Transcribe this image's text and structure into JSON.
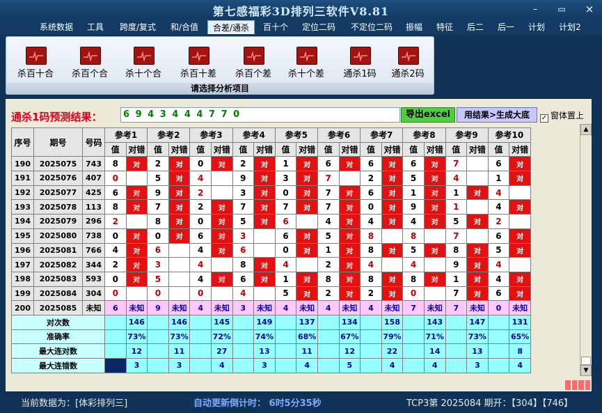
{
  "window": {
    "title": "第七感福彩3D排列三软件V8.81",
    "min_label": "–",
    "max_label": "▭",
    "close_label": "×"
  },
  "menu": [
    "系统数据",
    "工具",
    "跨度/复式",
    "和/合值",
    "合差/通杀",
    "百十个",
    "定位二码",
    "不定位二码",
    "振幅",
    "特征",
    "后二",
    "后一",
    "计划",
    "计划2"
  ],
  "menu_active_index": 4,
  "ribbon": {
    "buttons": [
      "杀百十合",
      "杀百个合",
      "杀十个合",
      "杀百十差",
      "杀百个差",
      "杀十个差",
      "通杀1码",
      "通杀2码"
    ],
    "footer": "请选择分析项目"
  },
  "prediction": {
    "label": "通杀1码预测结果：",
    "value": "6 9 4 3 4 4 4 7 7 0",
    "export_button": "导出excel",
    "generate_button": "用结果>生成大底",
    "checkbox_label": "窗体置上",
    "checkbox_checked": true
  },
  "table": {
    "col_seq": "序号",
    "col_period": "期号",
    "col_number": "号码",
    "ref_names": [
      "参考1",
      "参考2",
      "参考3",
      "参考4",
      "参考5",
      "参考6",
      "参考7",
      "参考8",
      "参考9",
      "参考10"
    ],
    "sub_value": "值",
    "sub_result": "对错",
    "rows": [
      {
        "seq": "190",
        "period": "2025075",
        "num": "743",
        "cells": [
          [
            8,
            1
          ],
          [
            2,
            1
          ],
          [
            0,
            1
          ],
          [
            2,
            1
          ],
          [
            1,
            1
          ],
          [
            6,
            1
          ],
          [
            6,
            1
          ],
          [
            6,
            1
          ],
          [
            7,
            0
          ],
          [
            6,
            1
          ]
        ]
      },
      {
        "seq": "191",
        "period": "2025076",
        "num": "407",
        "cells": [
          [
            0,
            0
          ],
          [
            5,
            1
          ],
          [
            4,
            0
          ],
          [
            9,
            1
          ],
          [
            3,
            1
          ],
          [
            7,
            0
          ],
          [
            2,
            1
          ],
          [
            5,
            1
          ],
          [
            4,
            0
          ],
          [
            1,
            1
          ]
        ]
      },
      {
        "seq": "192",
        "period": "2025077",
        "num": "425",
        "cells": [
          [
            6,
            1
          ],
          [
            9,
            1
          ],
          [
            2,
            0
          ],
          [
            3,
            1
          ],
          [
            0,
            1
          ],
          [
            7,
            1
          ],
          [
            6,
            1
          ],
          [
            1,
            1
          ],
          [
            1,
            1
          ],
          [
            4,
            0
          ]
        ]
      },
      {
        "seq": "193",
        "period": "2025078",
        "num": "113",
        "cells": [
          [
            8,
            1
          ],
          [
            7,
            1
          ],
          [
            2,
            1
          ],
          [
            7,
            1
          ],
          [
            7,
            1
          ],
          [
            7,
            1
          ],
          [
            0,
            1
          ],
          [
            9,
            1
          ],
          [
            1,
            0
          ],
          [
            4,
            1
          ]
        ]
      },
      {
        "seq": "194",
        "period": "2025079",
        "num": "296",
        "cells": [
          [
            2,
            0
          ],
          [
            8,
            1
          ],
          [
            0,
            1
          ],
          [
            5,
            1
          ],
          [
            6,
            0
          ],
          [
            4,
            1
          ],
          [
            4,
            1
          ],
          [
            4,
            1
          ],
          [
            5,
            1
          ],
          [
            2,
            0
          ]
        ]
      },
      {
        "seq": "195",
        "period": "2025080",
        "num": "738",
        "cells": [
          [
            0,
            1
          ],
          [
            0,
            1
          ],
          [
            6,
            1
          ],
          [
            3,
            0
          ],
          [
            6,
            1
          ],
          [
            5,
            1
          ],
          [
            8,
            0
          ],
          [
            8,
            0
          ],
          [
            7,
            0
          ],
          [
            6,
            1
          ]
        ]
      },
      {
        "seq": "196",
        "period": "2025081",
        "num": "766",
        "cells": [
          [
            4,
            1
          ],
          [
            6,
            0
          ],
          [
            4,
            1
          ],
          [
            6,
            0
          ],
          [
            0,
            1
          ],
          [
            1,
            1
          ],
          [
            8,
            1
          ],
          [
            5,
            1
          ],
          [
            8,
            1
          ],
          [
            5,
            1
          ]
        ]
      },
      {
        "seq": "197",
        "period": "2025082",
        "num": "344",
        "cells": [
          [
            2,
            1
          ],
          [
            3,
            0
          ],
          [
            4,
            0
          ],
          [
            8,
            1
          ],
          [
            4,
            0
          ],
          [
            2,
            1
          ],
          [
            4,
            0
          ],
          [
            4,
            0
          ],
          [
            9,
            1
          ],
          [
            4,
            0
          ]
        ]
      },
      {
        "seq": "198",
        "period": "2025083",
        "num": "593",
        "cells": [
          [
            0,
            1
          ],
          [
            5,
            0
          ],
          [
            4,
            1
          ],
          [
            6,
            1
          ],
          [
            1,
            1
          ],
          [
            8,
            1
          ],
          [
            8,
            1
          ],
          [
            8,
            1
          ],
          [
            1,
            1
          ],
          [
            4,
            1
          ]
        ]
      },
      {
        "seq": "199",
        "period": "2025084",
        "num": "304",
        "cells": [
          [
            0,
            0
          ],
          [
            0,
            0
          ],
          [
            0,
            0
          ],
          [
            4,
            0
          ],
          [
            5,
            1
          ],
          [
            2,
            1
          ],
          [
            2,
            1
          ],
          [
            0,
            0
          ],
          [
            7,
            1
          ],
          [
            6,
            1
          ]
        ]
      }
    ],
    "pred_row": {
      "seq": "200",
      "period": "2025085",
      "num": "未知",
      "values": [
        "6",
        "9",
        "4",
        "3",
        "4",
        "4",
        "4",
        "7",
        "7",
        "0"
      ],
      "unknown": "未知"
    },
    "stats": [
      {
        "label": "对次数",
        "values": [
          "146",
          "146",
          "145",
          "149",
          "137",
          "134",
          "158",
          "143",
          "147",
          "131"
        ]
      },
      {
        "label": "准确率",
        "values": [
          "73%",
          "73%",
          "72%",
          "74%",
          "68%",
          "67%",
          "79%",
          "71%",
          "73%",
          "65%"
        ]
      },
      {
        "label": "最大连对数",
        "values": [
          "12",
          "11",
          "27",
          "13",
          "11",
          "12",
          "22",
          "14",
          "13",
          "8"
        ]
      },
      {
        "label": "最大连错数",
        "values": [
          "3",
          "3",
          "4",
          "3",
          "4",
          "5",
          "4",
          "4",
          "3",
          "4"
        ]
      }
    ],
    "hit_label": "对"
  },
  "status": {
    "data_source": "当前数据为：[体彩排列三]",
    "countdown": "自动更新倒计时：  6时5分35秒",
    "issue": "TCP3第 2025084 期开：【304】【746】"
  },
  "colors": {
    "hit": "#e21212",
    "value_red": "#c00000",
    "pred_row": "#ffc8ff",
    "stats": "#96ffff",
    "background": "#0f3256"
  },
  "icons": {
    "ribbon_button": "chart-icon",
    "scroll_up": "arrow-up-icon",
    "scroll_down": "arrow-down-icon"
  }
}
